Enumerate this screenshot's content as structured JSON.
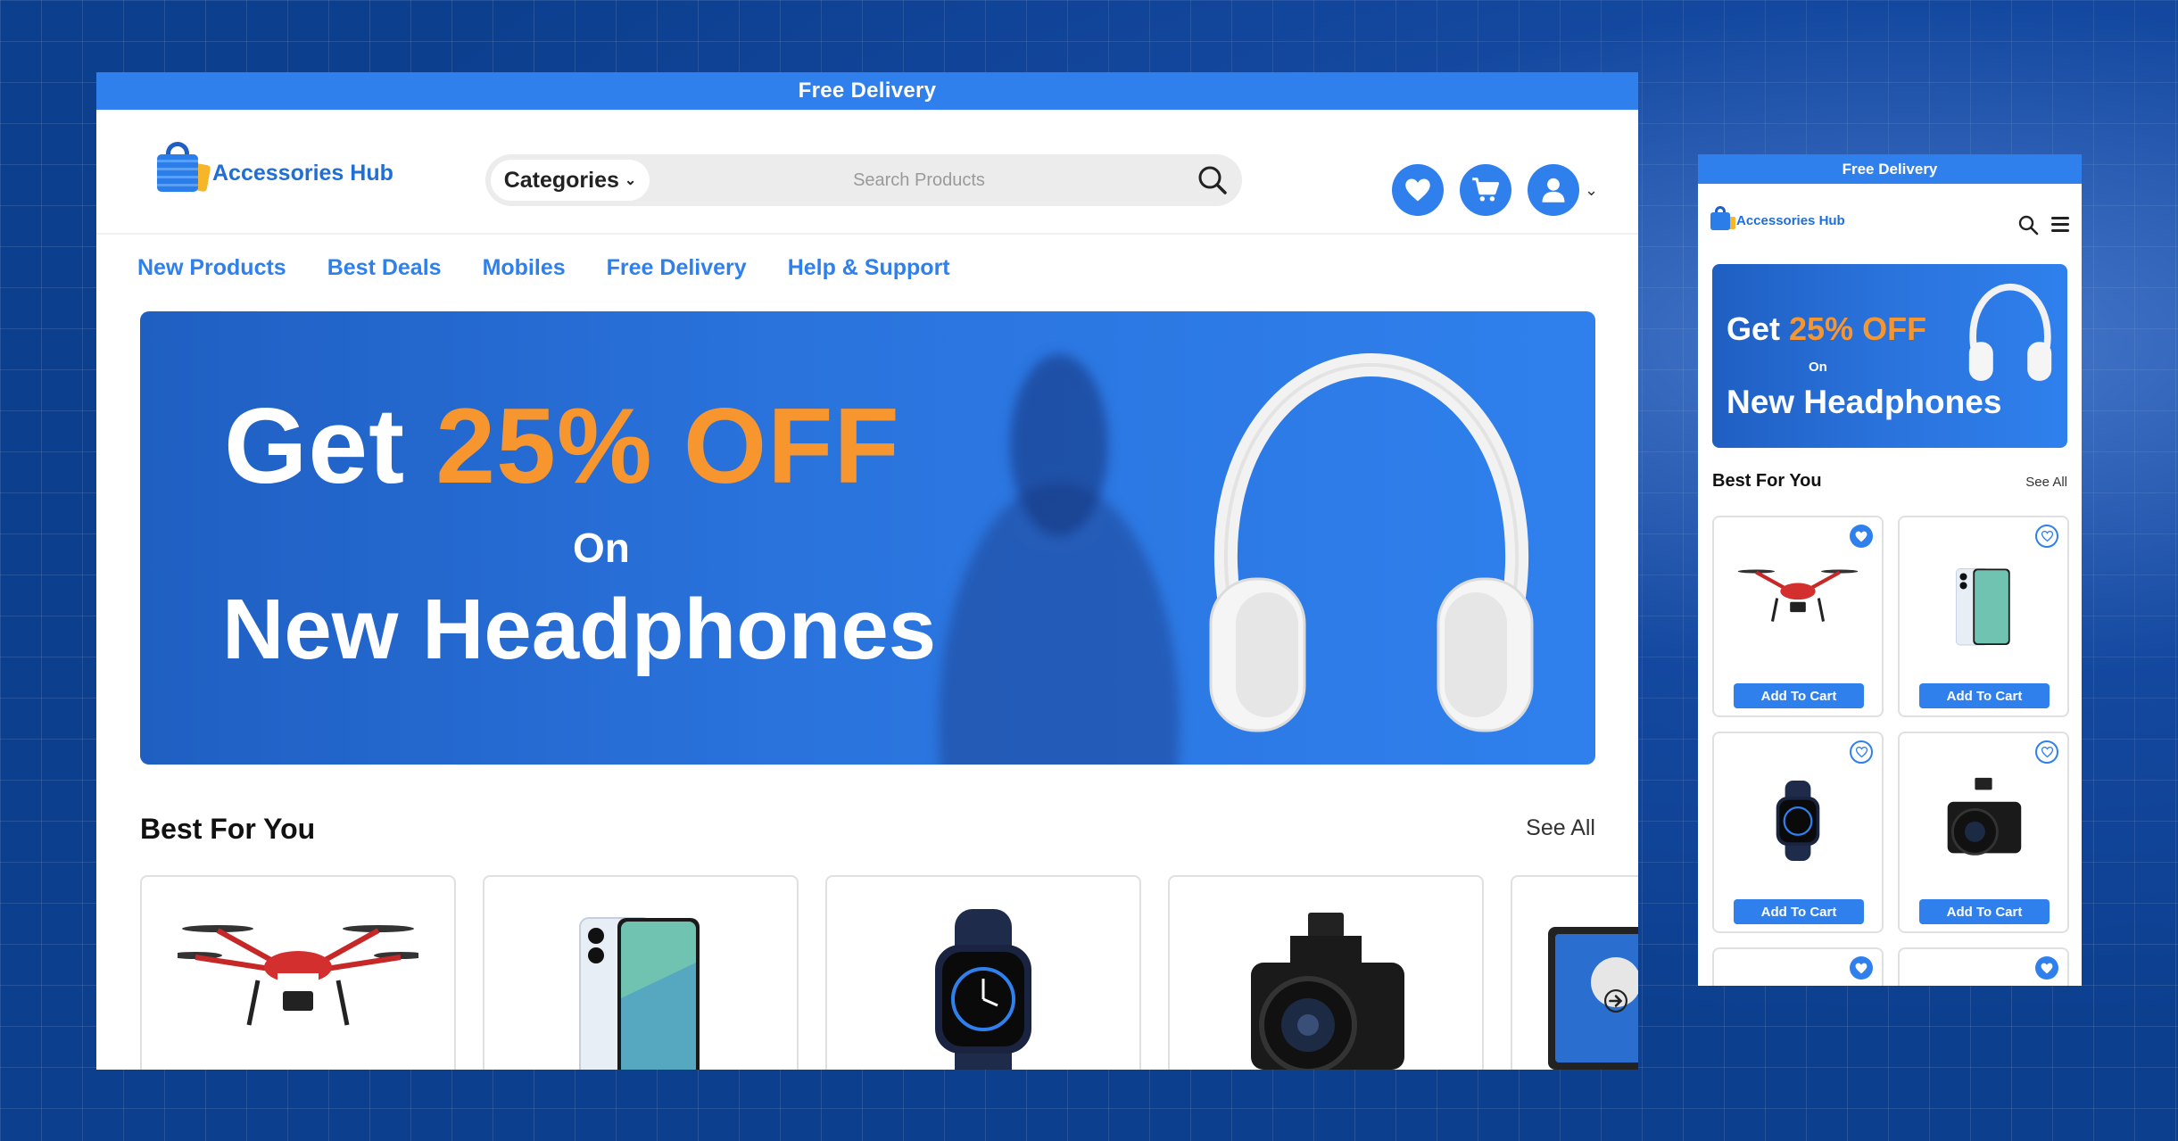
{
  "desktop": {
    "topbar": {
      "text": "Free Delivery"
    },
    "logo": {
      "text": "Accessories Hub"
    },
    "search": {
      "categories_label": "Categories",
      "placeholder": "Search Products"
    },
    "header_icons": [
      "heart-icon",
      "cart-icon",
      "user-icon"
    ],
    "nav": [
      {
        "label": "New Products"
      },
      {
        "label": "Best Deals"
      },
      {
        "label": "Mobiles"
      },
      {
        "label": "Free Delivery"
      },
      {
        "label": "Help & Support"
      }
    ],
    "hero": {
      "get": "Get",
      "discount": "25% OFF",
      "on": "On",
      "product": "New Headphones"
    },
    "section": {
      "title": "Best For You",
      "see_all": "See All"
    },
    "products": [
      "drone",
      "smartphone",
      "smartwatch",
      "camera",
      "laptop"
    ]
  },
  "mobile": {
    "topbar": {
      "text": "Free Delivery"
    },
    "logo": {
      "text": "Accessories Hub"
    },
    "hero": {
      "get": "Get",
      "discount": "25% OFF",
      "on": "On",
      "product": "New Headphones"
    },
    "section": {
      "title": "Best For You",
      "see_all": "See All"
    },
    "cards": [
      {
        "product": "drone",
        "favorited": true,
        "button": "Add To Cart"
      },
      {
        "product": "smartphone",
        "favorited": false,
        "button": "Add To Cart"
      },
      {
        "product": "smartwatch",
        "favorited": false,
        "button": "Add To Cart"
      },
      {
        "product": "camera",
        "favorited": false,
        "button": "Add To Cart"
      },
      {
        "product": "unknown",
        "favorited": true,
        "button": ""
      },
      {
        "product": "unknown",
        "favorited": true,
        "button": ""
      }
    ]
  },
  "colors": {
    "brand": "#2f80ed",
    "accent": "#f7962e",
    "background": "#0d3f8f"
  }
}
